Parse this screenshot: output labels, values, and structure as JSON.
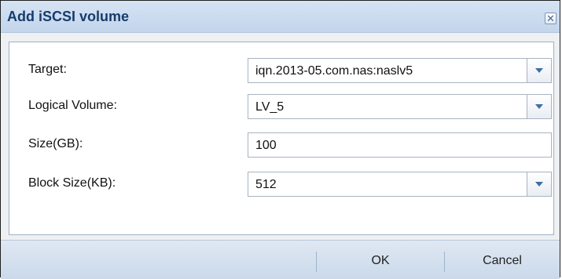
{
  "dialog": {
    "title": "Add iSCSI volume",
    "close_glyph": "✕"
  },
  "form": {
    "target": {
      "label": "Target:",
      "value": "iqn.2013-05.com.nas:naslv5"
    },
    "logical_volume": {
      "label": "Logical Volume:",
      "value": "LV_5"
    },
    "size": {
      "label": "Size(GB):",
      "value": "100"
    },
    "block_size": {
      "label": "Block Size(KB):",
      "value": "512"
    }
  },
  "buttons": {
    "ok_label": "OK",
    "cancel_label": "Cancel"
  },
  "colors": {
    "title_text": "#163c6b",
    "dropdown_arrow": "#3d6fa6"
  }
}
